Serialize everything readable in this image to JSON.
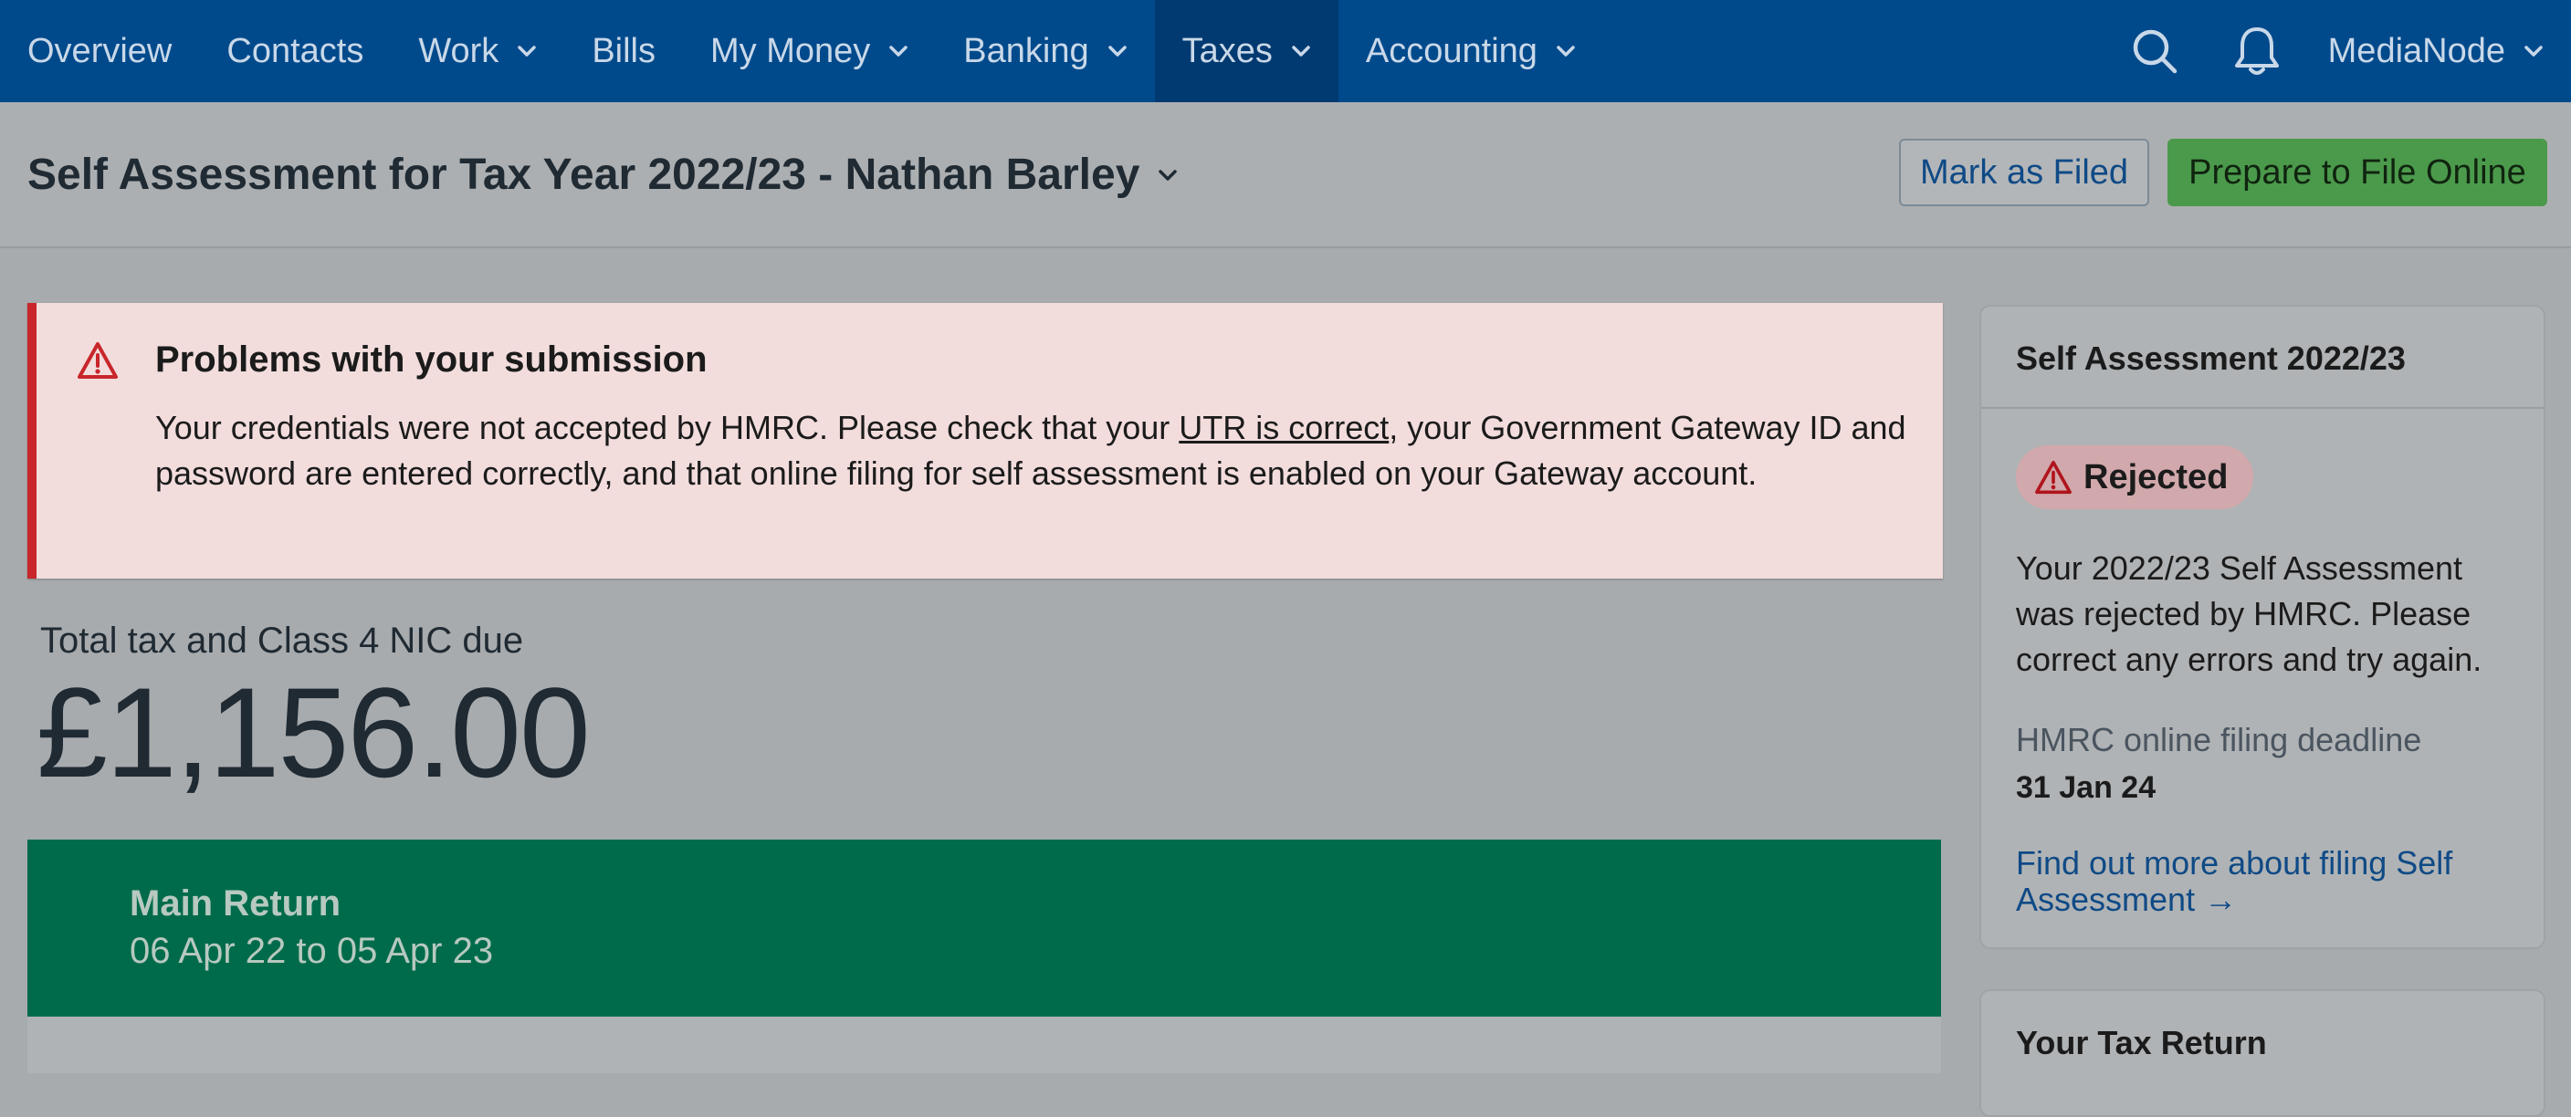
{
  "nav": {
    "items": [
      {
        "label": "Overview",
        "dropdown": false,
        "active": false
      },
      {
        "label": "Contacts",
        "dropdown": false,
        "active": false
      },
      {
        "label": "Work",
        "dropdown": true,
        "active": false
      },
      {
        "label": "Bills",
        "dropdown": false,
        "active": false
      },
      {
        "label": "My Money",
        "dropdown": true,
        "active": false
      },
      {
        "label": "Banking",
        "dropdown": true,
        "active": false
      },
      {
        "label": "Taxes",
        "dropdown": true,
        "active": true
      },
      {
        "label": "Accounting",
        "dropdown": true,
        "active": false
      }
    ],
    "account_label": "MediaNode",
    "icons": [
      "search-icon",
      "bell-icon",
      "chevron-down-icon"
    ]
  },
  "header": {
    "title": "Self Assessment for Tax Year 2022/23 - Nathan Barley",
    "mark_filed_label": "Mark as Filed",
    "prepare_label": "Prepare to File Online"
  },
  "alert": {
    "title": "Problems with your submission",
    "body_before": "Your credentials were not accepted by HMRC. Please check that your ",
    "link_text": "UTR is correct",
    "body_after": ", your Government Gateway ID and password are entered correctly, and that online filing for self assessment is enabled on your Gateway account."
  },
  "total": {
    "label": "Total tax and Class 4 NIC due",
    "value": "£1,156.00"
  },
  "main_return": {
    "title": "Main Return",
    "dates": "06 Apr 22 to 05 Apr 23"
  },
  "side_card": {
    "title": "Self Assessment 2022/23",
    "status": "Rejected",
    "description": "Your 2022/23 Self Assessment was rejected by HMRC. Please correct any errors and try again.",
    "deadline_label": "HMRC online filing deadline",
    "deadline_value": "31 Jan 24",
    "link_text": "Find out more about filing Self Assessment →"
  },
  "side_card_2": {
    "title": "Your Tax Return"
  },
  "colors": {
    "nav_bg": "#004a8c",
    "alert_border": "#c8262b",
    "primary_button": "#4b9a4c",
    "return_banner": "#006b4b",
    "link": "#0f4a86"
  }
}
